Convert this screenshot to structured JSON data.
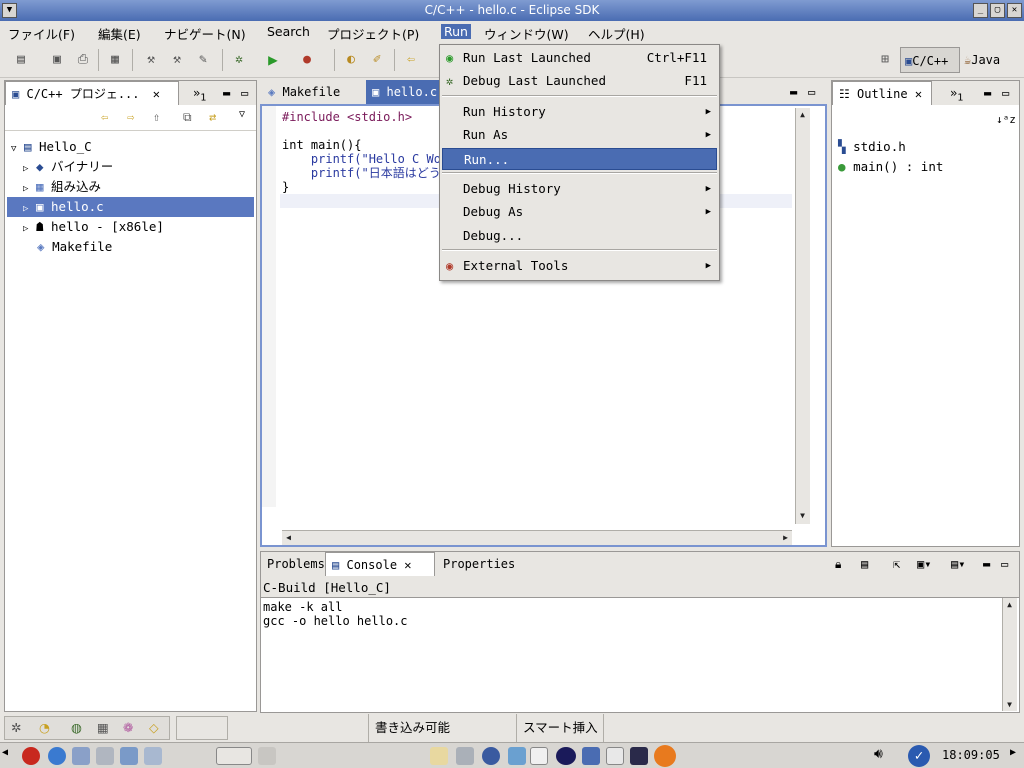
{
  "window": {
    "title": "C/C++ - hello.c - Eclipse SDK"
  },
  "menubar": {
    "items": [
      "ファイル(F)",
      "編集(E)",
      "ナビゲート(N)",
      "Search",
      "プロジェクト(P)",
      "Run",
      "ウィンドウ(W)",
      "ヘルプ(H)"
    ]
  },
  "perspectives": {
    "cpp": "C/C++",
    "java": "Java"
  },
  "navigator": {
    "tab": "C/C++ プロジェ...",
    "tab_count": "1",
    "items": [
      {
        "label": "Hello_C"
      },
      {
        "label": "バイナリー"
      },
      {
        "label": "組み込み"
      },
      {
        "label": "hello.c"
      },
      {
        "label": "hello - [x86le]"
      },
      {
        "label": "Makefile"
      }
    ]
  },
  "editor": {
    "tabs": [
      "Makefile",
      "hello.c"
    ],
    "lines": [
      "#include <stdio.h>",
      "",
      "int main(){",
      "    printf(\"Hello C Wor",
      "    printf(\"日本語はどう",
      "}"
    ]
  },
  "outline": {
    "tab": "Outline",
    "tab_count": "1",
    "items": [
      "stdio.h",
      "main() : int"
    ]
  },
  "bottom": {
    "tabs": [
      "Problems",
      "Console",
      "Properties"
    ],
    "console_title": "C-Build [Hello_C]",
    "console_lines": [
      "make -k all",
      "gcc -o hello hello.c"
    ]
  },
  "run_menu": {
    "items": [
      {
        "label": "Run Last Launched",
        "accel": "Ctrl+F11"
      },
      {
        "label": "Debug Last Launched",
        "accel": "F11"
      },
      {
        "label": "Run History"
      },
      {
        "label": "Run As"
      },
      {
        "label": "Run..."
      },
      {
        "label": "Debug History"
      },
      {
        "label": "Debug As"
      },
      {
        "label": "Debug..."
      },
      {
        "label": "External Tools"
      }
    ]
  },
  "status": {
    "writable": "書き込み可能",
    "insert_mode": "スマート挿入"
  },
  "taskbar": {
    "clock": "18:09:05"
  }
}
